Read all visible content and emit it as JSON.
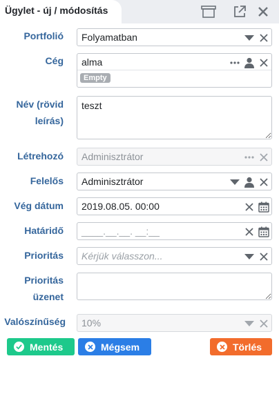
{
  "header": {
    "title": "Ügylet - új / módosítás"
  },
  "form": {
    "portfolio": {
      "label": "Portfolió",
      "value": "Folyamatban"
    },
    "ceg": {
      "label": "Cég",
      "value": "alma",
      "badge": "Empty"
    },
    "nev": {
      "label_line1": "Név (rövid",
      "label_line2": "leírás)",
      "value": "teszt"
    },
    "letrehozo": {
      "label": "Létrehozó",
      "value": "Adminisztrátor"
    },
    "felelos": {
      "label": "Felelős",
      "value": "Adminisztrátor"
    },
    "veg_datum": {
      "label": "Vég dátum",
      "value": "2019.08.05. 00:00"
    },
    "hatarido": {
      "label": "Határidő",
      "placeholder": "____.__.__. __:__"
    },
    "prioritas": {
      "label": "Prioritás",
      "placeholder": "Kérjük válasszon..."
    },
    "prioritas_uzenet": {
      "label_line1": "Prioritás",
      "label_line2": "üzenet",
      "value": ""
    },
    "valoszinuseg": {
      "label": "Valószínűség",
      "value": "10%"
    }
  },
  "buttons": {
    "save": "Mentés",
    "cancel": "Mégsem",
    "delete": "Törlés"
  },
  "colors": {
    "save": "#1dc98b",
    "cancel": "#2b7ee6",
    "delete": "#f26c2c",
    "label": "#35669c"
  }
}
